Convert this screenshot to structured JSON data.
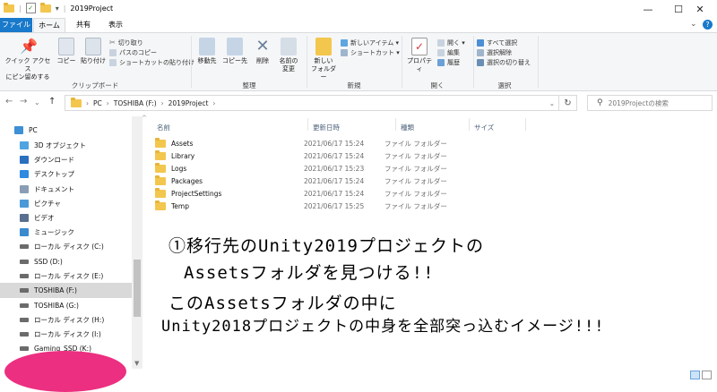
{
  "window": {
    "title": "2019Project",
    "controls": {
      "minimize": "—",
      "maximize": "☐",
      "close": "✕"
    }
  },
  "ribbon": {
    "tabs": [
      "ファイル",
      "ホーム",
      "共有",
      "表示"
    ],
    "clipboard": {
      "label": "クリップボード",
      "pin_label_1": "クイック アクセス",
      "pin_label_2": "にピン留めする",
      "copy": "コピー",
      "paste": "貼り付け",
      "cut": "切り取り",
      "copy_path": "パスのコピー",
      "paste_shortcut": "ショートカットの貼り付け"
    },
    "organize": {
      "label": "整理",
      "move_to": "移動先",
      "copy_to": "コピー先",
      "delete": "削除",
      "rename_1": "名前の",
      "rename_2": "変更"
    },
    "new": {
      "label": "新規",
      "new_folder_1": "新しい",
      "new_folder_2": "フォルダー",
      "new_item": "新しいアイテム ▾",
      "shortcut": "ショートカット ▾"
    },
    "open": {
      "label": "開く",
      "properties": "プロパティ",
      "open": "開く ▾",
      "edit": "編集",
      "history": "履歴"
    },
    "select": {
      "label": "選択",
      "select_all": "すべて選択",
      "select_none": "選択解除",
      "invert": "選択の切り替え"
    }
  },
  "address": {
    "path": [
      "PC",
      "TOSHIBA (F:)",
      "2019Project"
    ],
    "search_placeholder": "2019Projectの検索"
  },
  "navpane": {
    "items": [
      {
        "label": "PC",
        "icon": "pc-icon",
        "color": "#3d8fd6"
      },
      {
        "label": "3D オブジェクト",
        "icon": "cube-icon",
        "color": "#4fa3e0"
      },
      {
        "label": "ダウンロード",
        "icon": "download-icon",
        "color": "#2a6fc0"
      },
      {
        "label": "デスクトップ",
        "icon": "desktop-icon",
        "color": "#2f8ae0"
      },
      {
        "label": "ドキュメント",
        "icon": "document-icon",
        "color": "#8a9db5"
      },
      {
        "label": "ピクチャ",
        "icon": "picture-icon",
        "color": "#4a9ad8"
      },
      {
        "label": "ビデオ",
        "icon": "video-icon",
        "color": "#5a6f8f"
      },
      {
        "label": "ミュージック",
        "icon": "music-icon",
        "color": "#3a8ad0"
      },
      {
        "label": "ローカル ディスク (C:)",
        "icon": "drive-icon",
        "color": "#6b6b6b"
      },
      {
        "label": "SSD (D:)",
        "icon": "drive-icon",
        "color": "#6b6b6b"
      },
      {
        "label": "ローカル ディスク (E:)",
        "icon": "drive-icon",
        "color": "#6b6b6b"
      },
      {
        "label": "TOSHIBA (F:)",
        "icon": "drive-icon",
        "color": "#6b6b6b"
      },
      {
        "label": "TOSHIBA (G:)",
        "icon": "drive-icon",
        "color": "#6b6b6b"
      },
      {
        "label": "ローカル ディスク (H:)",
        "icon": "drive-icon",
        "color": "#6b6b6b"
      },
      {
        "label": "ローカル ディスク (I:)",
        "icon": "drive-icon",
        "color": "#6b6b6b"
      },
      {
        "label": "Gaming_SSD (K:)",
        "icon": "drive-icon",
        "color": "#6b6b6b"
      }
    ],
    "selected_index": 11
  },
  "filelist": {
    "columns": [
      "名前",
      "更新日時",
      "種類",
      "サイズ"
    ],
    "rows": [
      {
        "name": "Assets",
        "date": "2021/06/17 15:24",
        "type": "ファイル フォルダー"
      },
      {
        "name": "Library",
        "date": "2021/06/17 15:24",
        "type": "ファイル フォルダー"
      },
      {
        "name": "Logs",
        "date": "2021/06/17 15:23",
        "type": "ファイル フォルダー"
      },
      {
        "name": "Packages",
        "date": "2021/06/17 15:24",
        "type": "ファイル フォルダー"
      },
      {
        "name": "ProjectSettings",
        "date": "2021/06/17 15:24",
        "type": "ファイル フォルダー"
      },
      {
        "name": "Temp",
        "date": "2021/06/17 15:25",
        "type": "ファイル フォルダー"
      }
    ]
  },
  "annotation": {
    "line1": "①移行先のUnity2019プロジェクトの",
    "line2": "Assetsフォルダを見つける!!",
    "line3": "このAssetsフォルダの中に",
    "line4": "Unity2018プロジェクトの中身を全部突っ込むイメージ!!!"
  },
  "colors": {
    "accent": "#1979ca",
    "folder": "#f3c64e",
    "highlight": "#ec2f80"
  }
}
